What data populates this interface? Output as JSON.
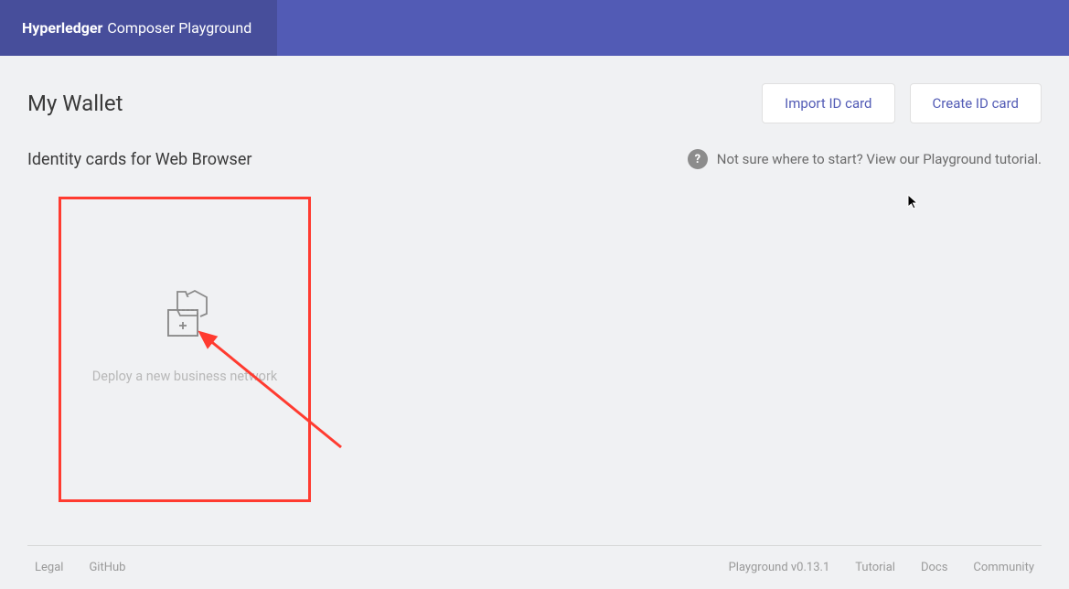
{
  "header": {
    "brand_bold": "Hyperledger",
    "brand_rest": "Composer Playground"
  },
  "page": {
    "title": "My Wallet",
    "subtitle": "Identity cards for Web Browser"
  },
  "buttons": {
    "import": "Import ID card",
    "create": "Create ID card"
  },
  "help": {
    "icon": "?",
    "text": "Not sure where to start? View our Playground tutorial."
  },
  "card": {
    "deploy_label": "Deploy a new business network"
  },
  "footer": {
    "legal": "Legal",
    "github": "GitHub",
    "version": "Playground v0.13.1",
    "tutorial": "Tutorial",
    "docs": "Docs",
    "community": "Community"
  }
}
